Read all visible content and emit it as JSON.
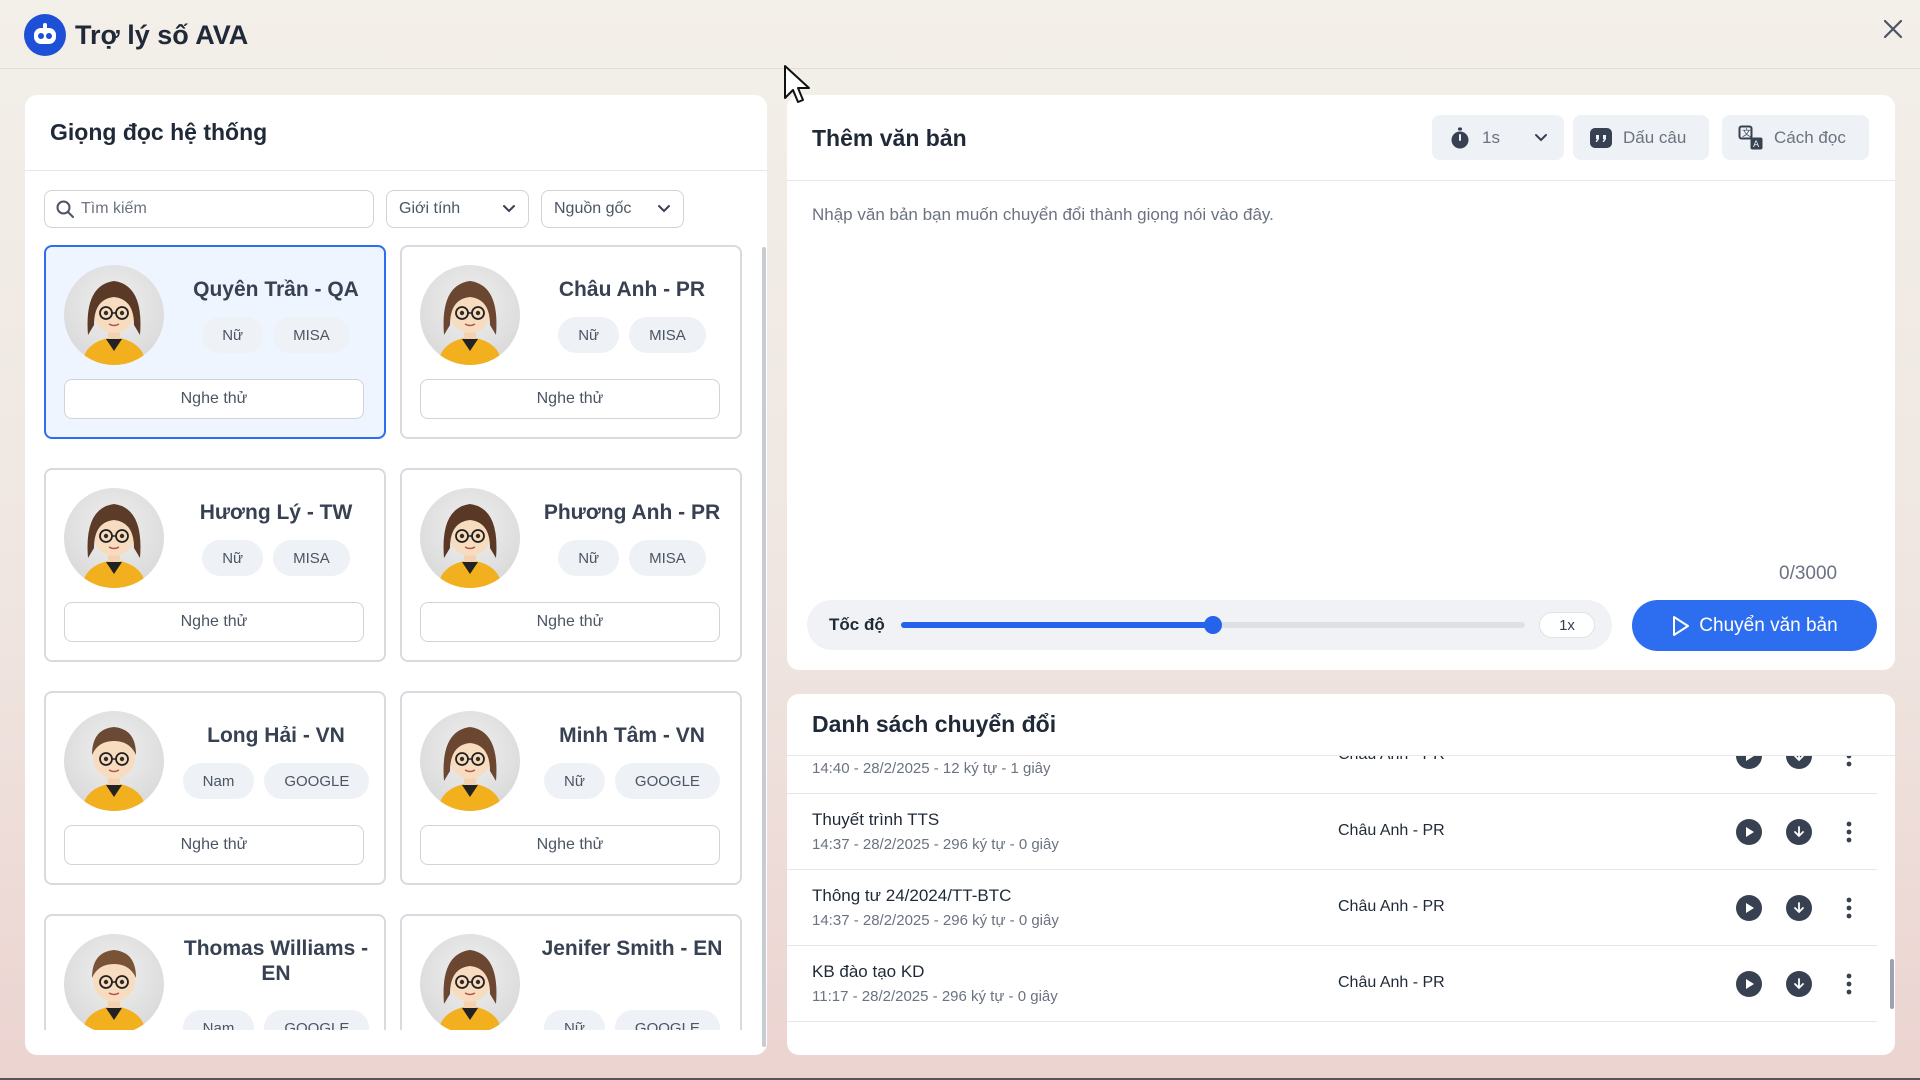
{
  "app": {
    "title": "Trợ lý số AVA"
  },
  "voices_panel": {
    "title": "Giọng đọc hệ thống",
    "search_placeholder": "Tìm kiếm",
    "filter_gender": "Giới tính",
    "filter_source": "Nguồn gốc",
    "listen_label": "Nghe thử",
    "voices": [
      {
        "name": "Quyên Trần - QA",
        "gender": "Nữ",
        "source": "MISA",
        "selected": true
      },
      {
        "name": "Châu Anh - PR",
        "gender": "Nữ",
        "source": "MISA"
      },
      {
        "name": "Hương Lý - TW",
        "gender": "Nữ",
        "source": "MISA"
      },
      {
        "name": "Phương Anh - PR",
        "gender": "Nữ",
        "source": "MISA"
      },
      {
        "name": "Long Hải - VN",
        "gender": "Nam",
        "source": "GOOGLE"
      },
      {
        "name": "Minh Tâm - VN",
        "gender": "Nữ",
        "source": "GOOGLE"
      },
      {
        "name": "Thomas Williams - EN",
        "gender": "Nam",
        "source": "GOOGLE"
      },
      {
        "name": "Jenifer Smith - EN",
        "gender": "Nữ",
        "source": "GOOGLE"
      }
    ]
  },
  "text_panel": {
    "title": "Thêm văn bản",
    "pause_value": "1s",
    "punctuation_label": "Dấu câu",
    "reading_label": "Cách đọc",
    "placeholder": "Nhập văn bản bạn muốn chuyển đổi thành giọng nói vào đây.",
    "char_count": "0/3000",
    "speed_label": "Tốc độ",
    "speed_value": "1x",
    "speed_fraction": 0.5,
    "convert_label": "Chuyển văn bản"
  },
  "conversions": {
    "title": "Danh sách chuyển đổi",
    "items": [
      {
        "name": "",
        "meta": "14:40 - 28/2/2025 - 12 ký tự - 1 giây",
        "voice": "Châu Anh - PR"
      },
      {
        "name": "Thuyết trình TTS",
        "meta": "14:37 - 28/2/2025 - 296 ký tự - 0 giây",
        "voice": "Châu Anh - PR"
      },
      {
        "name": "Thông tư 24/2024/TT-BTC",
        "meta": "14:37 - 28/2/2025 - 296 ký tự - 0 giây",
        "voice": "Châu Anh - PR"
      },
      {
        "name": "KB đào tạo KD",
        "meta": "11:17 - 28/2/2025 - 296 ký tự - 0 giây",
        "voice": "Châu Anh - PR"
      }
    ]
  },
  "colors": {
    "accent": "#2d6ef0",
    "selected_bg": "#eef5ff",
    "brand": "#1d4fd7"
  },
  "icons": {
    "logo": "robot-logo-icon",
    "close": "close-icon",
    "search": "search-icon",
    "timer": "stopwatch-icon",
    "punctuation": "quote-icon",
    "reading": "translate-icon",
    "play": "play-icon",
    "download": "download-icon",
    "more": "more-vertical-icon"
  }
}
